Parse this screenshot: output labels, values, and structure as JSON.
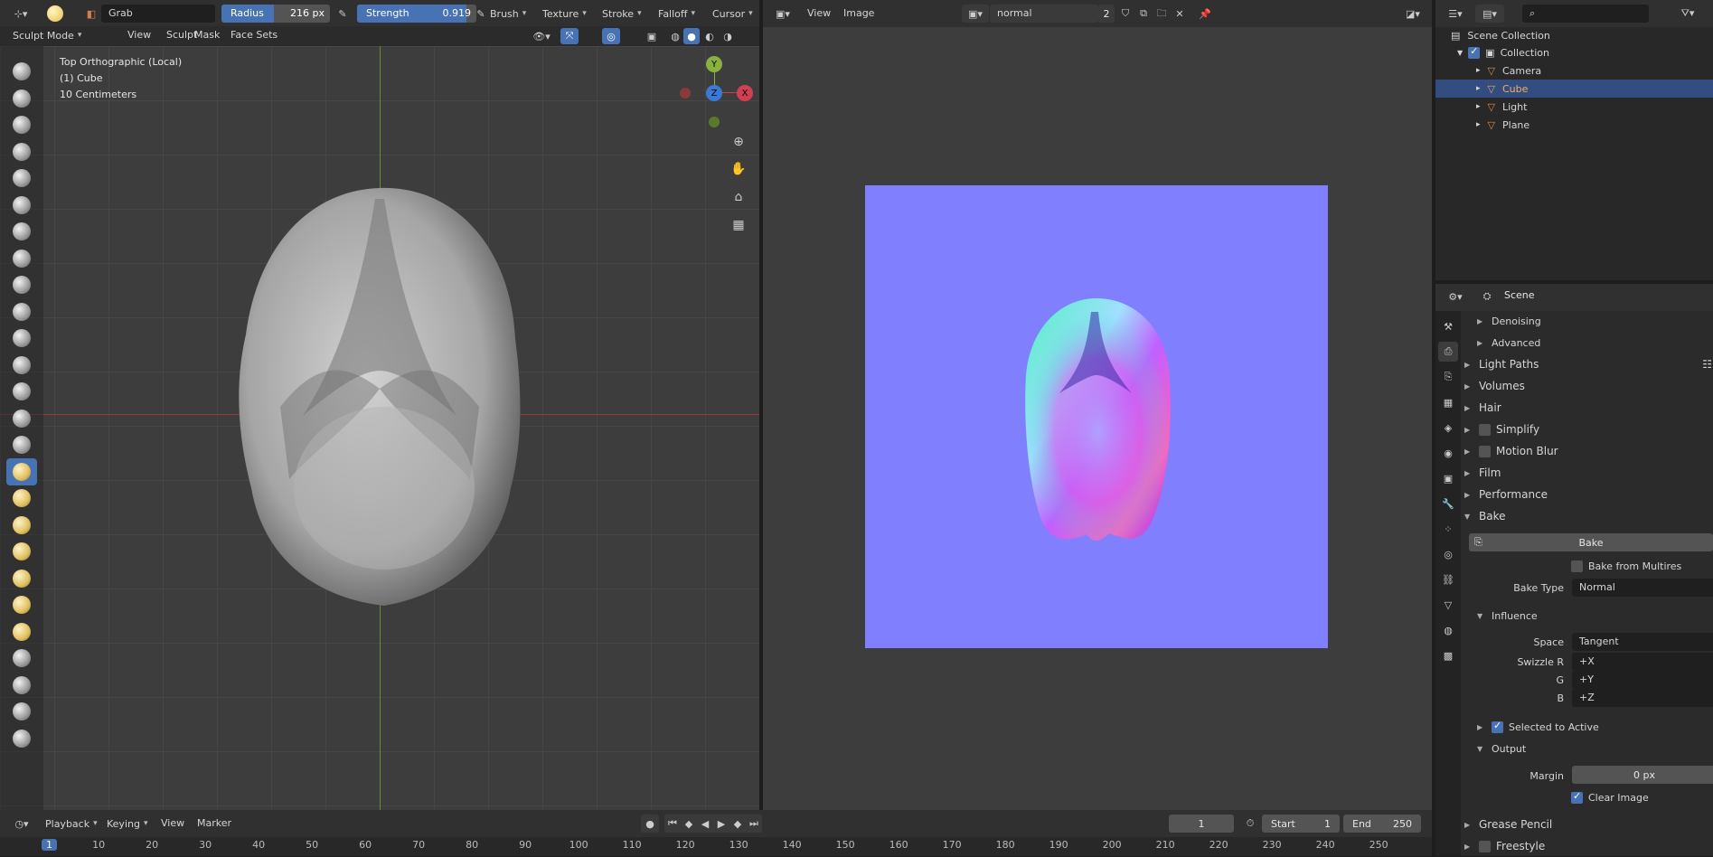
{
  "top_header": {
    "brush_name": "Grab",
    "radius_label": "Radius",
    "radius_value": "216 px",
    "strength_label": "Strength",
    "strength_value": "0.919",
    "strength_fraction": 0.919,
    "menus": [
      "Brush",
      "Texture",
      "Stroke",
      "Falloff",
      "Cursor"
    ]
  },
  "viewport_header": {
    "mode": "Sculpt Mode",
    "menus": [
      "View",
      "Sculpt",
      "Mask",
      "Face Sets"
    ]
  },
  "viewport_overlay": {
    "view_name": "Top Orthographic (Local)",
    "object": "(1) Cube",
    "scale": "10 Centimeters"
  },
  "gizmo": {
    "y": "Y",
    "x": "X",
    "z": "Z"
  },
  "image_editor": {
    "menus": [
      "View",
      "Image"
    ],
    "image_name": "normal",
    "users": "2"
  },
  "outliner": {
    "root": "Scene Collection",
    "collection": "Collection",
    "items": [
      {
        "label": "Camera",
        "color": "#d98e4f"
      },
      {
        "label": "Cube",
        "color": "#e8a85c"
      },
      {
        "label": "Light",
        "color": "#d98e4f"
      },
      {
        "label": "Plane",
        "color": "#d98e4f"
      }
    ]
  },
  "properties": {
    "scene_label": "Scene",
    "rows": {
      "denoising": "Denoising",
      "advanced": "Advanced",
      "light_paths": "Light Paths",
      "volumes": "Volumes",
      "hair": "Hair",
      "simplify": "Simplify",
      "motion_blur": "Motion Blur",
      "film": "Film",
      "performance": "Performance",
      "bake": "Bake",
      "bake_button": "Bake",
      "bake_from_multires": "Bake from Multires",
      "bake_type_label": "Bake Type",
      "bake_type_value": "Normal",
      "influence": "Influence",
      "space_label": "Space",
      "space_value": "Tangent",
      "swizzle_r_label": "Swizzle R",
      "swizzle_r_value": "+X",
      "g_label": "G",
      "g_value": "+Y",
      "b_label": "B",
      "b_value": "+Z",
      "selected_to_active": "Selected to Active",
      "output": "Output",
      "margin_label": "Margin",
      "margin_value": "0 px",
      "clear_image": "Clear Image",
      "grease_pencil": "Grease Pencil",
      "freestyle": "Freestyle"
    }
  },
  "timeline": {
    "menus": [
      "Playback",
      "Keying",
      "View",
      "Marker"
    ],
    "current_frame": "1",
    "start_label": "Start",
    "start_value": "1",
    "end_label": "End",
    "end_value": "250",
    "ticks": [
      "1",
      "10",
      "20",
      "30",
      "40",
      "50",
      "60",
      "70",
      "80",
      "90",
      "100",
      "110",
      "120",
      "130",
      "140",
      "150",
      "160",
      "170",
      "180",
      "190",
      "200",
      "210",
      "220",
      "230",
      "240",
      "250"
    ]
  }
}
